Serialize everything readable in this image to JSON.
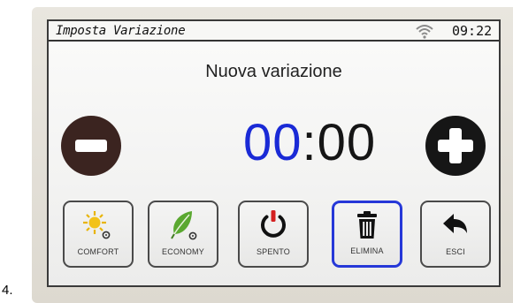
{
  "list_marker": "4.",
  "status_bar": {
    "title": "Imposta Variazione",
    "time": "09:22",
    "wifi_icon": "wifi-icon"
  },
  "heading": "Nuova variazione",
  "timer": {
    "hours": "00",
    "separator": ":",
    "minutes": "00"
  },
  "controls": {
    "decrease_icon": "minus-icon",
    "increase_icon": "plus-icon"
  },
  "buttons": [
    {
      "label": "COMFORT",
      "icon": "sun-icon",
      "selected": false
    },
    {
      "label": "ECONOMY",
      "icon": "leaf-icon",
      "selected": false
    },
    {
      "label": "SPENTO",
      "icon": "power-icon",
      "selected": false
    },
    {
      "label": "ELIMINA",
      "icon": "trash-icon",
      "selected": true
    },
    {
      "label": "ESCI",
      "icon": "back-arrow-icon",
      "selected": false
    }
  ],
  "colors": {
    "selected_border": "#2638d8",
    "hours_digits": "#1a2ad6",
    "minus_button": "#3b2420",
    "plus_button": "#161616"
  }
}
